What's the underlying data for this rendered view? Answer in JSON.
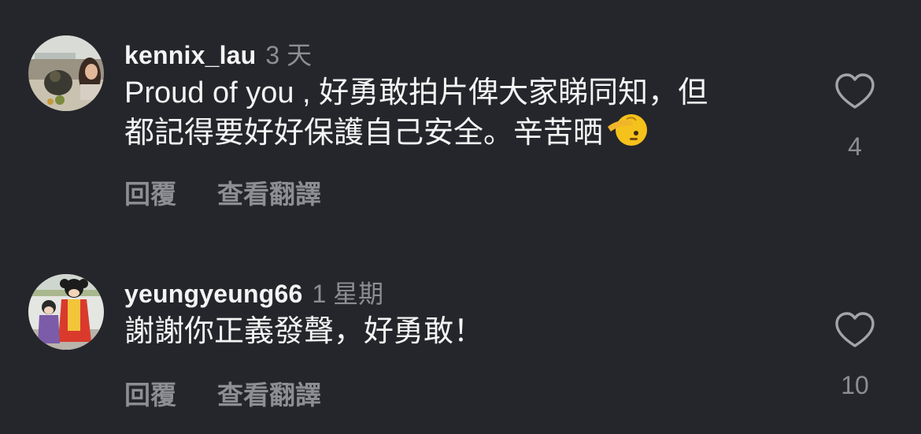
{
  "comments": [
    {
      "username": "kennix_lau",
      "time": "3 天",
      "text_line1": "Proud of you , 好勇敢拍片俾大家睇同知，但",
      "text_line2": "都記得要好好保護自己安全。辛苦晒",
      "emoji": "saluting-face-emoji",
      "reply_label": "回覆",
      "translate_label": "查看翻譯",
      "like_icon": "heart-outline-icon",
      "like_count": "4"
    },
    {
      "username": "yeungyeung66",
      "time": "1 星期",
      "text_line1": "謝謝你正義發聲，好勇敢！",
      "reply_label": "回覆",
      "translate_label": "查看翻譯",
      "like_icon": "heart-outline-icon",
      "like_count": "10"
    }
  ],
  "colors": {
    "background": "#25262b",
    "primary_text": "#f4f4f4",
    "secondary_text": "#8d8e93"
  }
}
